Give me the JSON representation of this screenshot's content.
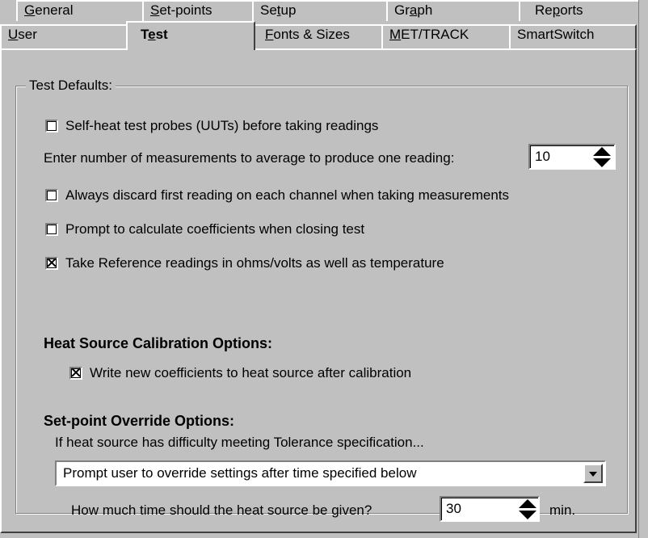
{
  "tabs_back": [
    {
      "pre": "",
      "u": "G",
      "post": "eneral"
    },
    {
      "pre": "",
      "u": "S",
      "post": "et-points"
    },
    {
      "pre": "Se",
      "u": "t",
      "post": "up"
    },
    {
      "pre": "Gr",
      "u": "a",
      "post": "ph"
    },
    {
      "pre": "Re",
      "u": "p",
      "post": "orts"
    }
  ],
  "tabs_front": [
    {
      "pre": "",
      "u": "U",
      "post": "ser"
    },
    {
      "pre": "T",
      "u": "e",
      "post": "st"
    },
    {
      "pre": "",
      "u": "F",
      "post": "onts & Sizes"
    },
    {
      "pre": "",
      "u": "M",
      "post": "ET/TRACK"
    },
    {
      "pre": "SmartSwitch",
      "u": "",
      "post": ""
    }
  ],
  "test_defaults": {
    "group_label": "Test Defaults:",
    "self_heat": {
      "label": "Self-heat test probes (UUTs) before taking readings",
      "checked": false
    },
    "average_label": "Enter number of measurements to average to produce one reading:",
    "average_value": "10",
    "discard_first": {
      "label": "Always discard first reading on each channel when taking measurements",
      "checked": false
    },
    "prompt_coeff": {
      "label": "Prompt to calculate coefficients when closing test",
      "checked": false
    },
    "take_reference": {
      "label": "Take Reference readings in ohms/volts as well as temperature",
      "checked": true
    }
  },
  "heat_source": {
    "heading": "Heat Source Calibration Options:",
    "write_coeff": {
      "label": "Write new coefficients to heat source after calibration",
      "checked": true
    }
  },
  "setpoint_override": {
    "heading": "Set-point Override Options:",
    "description": "If heat source has difficulty meeting Tolerance specification...",
    "dropdown_value": "Prompt user to override settings after time specified below",
    "time_label": "How much time should the heat source be given?",
    "time_value": "30",
    "time_unit": "min."
  }
}
